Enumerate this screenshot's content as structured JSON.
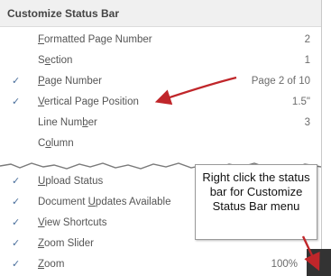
{
  "menu": {
    "title": "Customize Status Bar",
    "items": [
      {
        "prefix": "",
        "key": "F",
        "rest": "ormatted Page Number",
        "value": "2",
        "checked": false
      },
      {
        "prefix": "S",
        "key": "e",
        "rest": "ction",
        "value": "1",
        "checked": false
      },
      {
        "prefix": "",
        "key": "P",
        "rest": "age Number",
        "value": "Page 2 of 10",
        "checked": true
      },
      {
        "prefix": "",
        "key": "V",
        "rest": "ertical Page Position",
        "value": "1.5\"",
        "checked": true
      },
      {
        "prefix": "Line Num",
        "key": "b",
        "rest": "er",
        "value": "3",
        "checked": false
      },
      {
        "prefix": "C",
        "key": "o",
        "rest": "lumn",
        "value": "",
        "checked": false
      },
      {
        "prefix": "",
        "key": "U",
        "rest": "pload Status",
        "value": "",
        "checked": true
      },
      {
        "prefix": "Document ",
        "key": "U",
        "rest": "pdates Available",
        "value": "",
        "checked": true
      },
      {
        "prefix": "",
        "key": "V",
        "rest": "iew Shortcuts",
        "value": "",
        "checked": true
      },
      {
        "prefix": "",
        "key": "Z",
        "rest": "oom Slider",
        "value": "",
        "checked": true
      },
      {
        "prefix": "",
        "key": "Z",
        "rest": "oom",
        "value": "100%",
        "checked": true
      }
    ]
  },
  "callout": {
    "text": "Right click the status bar for Customize Status Bar menu"
  },
  "colors": {
    "arrow": "#c0262a",
    "check": "#4a6f9c",
    "header_bg": "#f0f0f0"
  },
  "icons": {
    "check": "checkmark-icon"
  }
}
